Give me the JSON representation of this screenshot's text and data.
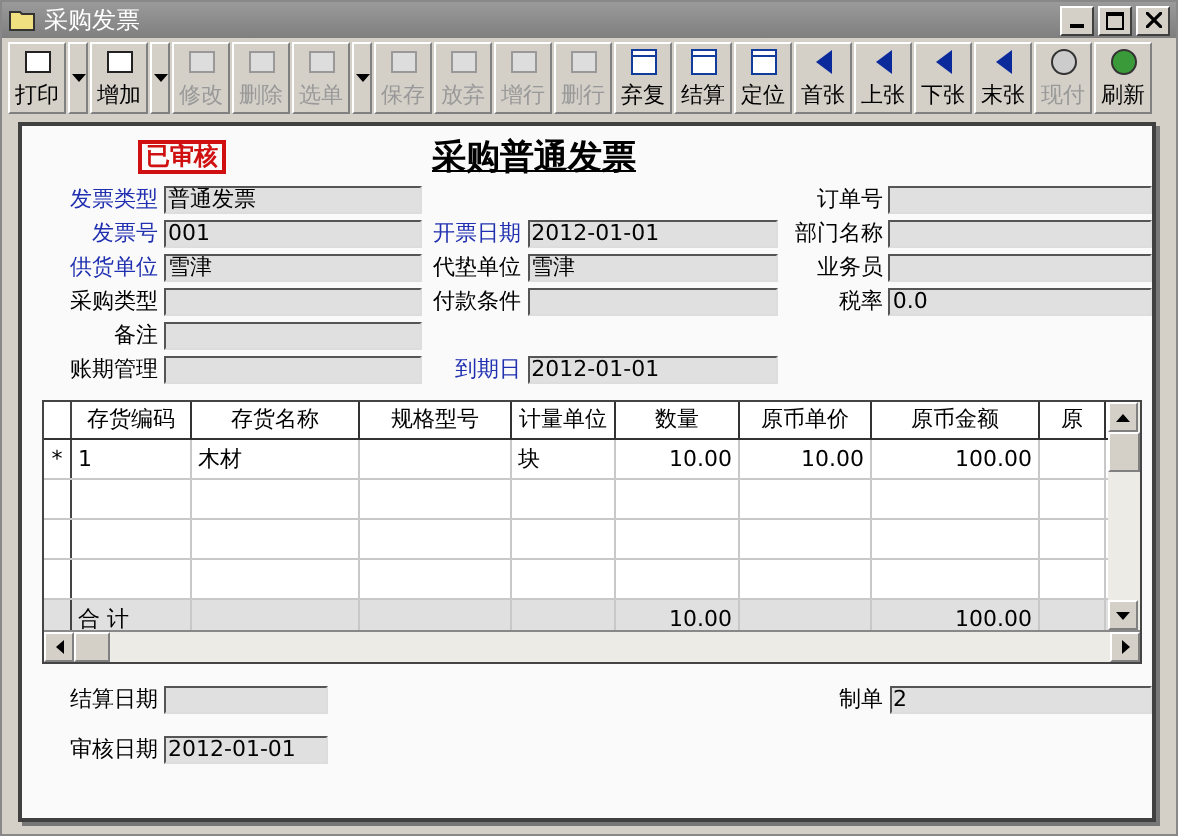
{
  "window": {
    "title": "采购发票"
  },
  "toolbar": [
    {
      "kind": "button",
      "label": "打印",
      "disabled": false
    },
    {
      "kind": "dropdown",
      "disabled": false
    },
    {
      "kind": "button",
      "label": "增加",
      "disabled": false
    },
    {
      "kind": "dropdown",
      "disabled": false
    },
    {
      "kind": "button",
      "label": "修改",
      "disabled": true
    },
    {
      "kind": "button",
      "label": "删除",
      "disabled": true
    },
    {
      "kind": "button",
      "label": "选单",
      "disabled": true
    },
    {
      "kind": "dropdown",
      "disabled": false
    },
    {
      "kind": "button",
      "label": "保存",
      "disabled": true
    },
    {
      "kind": "button",
      "label": "放弃",
      "disabled": true
    },
    {
      "kind": "button",
      "label": "增行",
      "disabled": true
    },
    {
      "kind": "button",
      "label": "删行",
      "disabled": true
    },
    {
      "kind": "button",
      "label": "弃复",
      "disabled": false
    },
    {
      "kind": "button",
      "label": "结算",
      "disabled": false
    },
    {
      "kind": "button",
      "label": "定位",
      "disabled": false
    },
    {
      "kind": "button",
      "label": "首张",
      "disabled": false
    },
    {
      "kind": "button",
      "label": "上张",
      "disabled": false
    },
    {
      "kind": "button",
      "label": "下张",
      "disabled": false
    },
    {
      "kind": "button",
      "label": "末张",
      "disabled": false
    },
    {
      "kind": "button",
      "label": "现付",
      "disabled": true
    },
    {
      "kind": "button",
      "label": "刷新",
      "disabled": false
    }
  ],
  "stamp": "已审核",
  "form_title": "采购普通发票",
  "header_rows": [
    {
      "left": {
        "label": "发票类型",
        "required": true,
        "value": "普通发票"
      },
      "right": {
        "label": "订单号",
        "required": false
      }
    },
    {
      "left": {
        "label": "发票号",
        "required": true,
        "value": "001"
      },
      "middle": {
        "label": "开票日期",
        "required": true,
        "value": "2012-01-01"
      },
      "right": {
        "label": "部门名称",
        "required": false
      }
    },
    {
      "left": {
        "label": "供货单位",
        "required": true,
        "value": "雪津"
      },
      "middle": {
        "label": "代垫单位",
        "required": false,
        "value": "雪津"
      },
      "right": {
        "label": "业务员",
        "required": false
      }
    },
    {
      "left": {
        "label": "采购类型",
        "required": false
      },
      "middle": {
        "label": "付款条件",
        "required": false
      },
      "right": {
        "label": "税率",
        "required": false,
        "value": "0.0"
      }
    },
    {
      "left": {
        "label": "备注",
        "required": false
      }
    },
    {
      "left": {
        "label": "账期管理",
        "required": false
      },
      "middle": {
        "label": "到期日",
        "required": true,
        "value": "2012-01-01"
      }
    }
  ],
  "table": {
    "columns": [
      "存货编码",
      "存货名称",
      "规格型号",
      "计量单位",
      "数量",
      "原币单价",
      "原币金额",
      "原"
    ],
    "rows": [
      {
        "marker": "*",
        "cells": [
          "1",
          "木材",
          "",
          "块",
          "10.00",
          "10.00",
          "100.00",
          ""
        ]
      }
    ],
    "total": {
      "label": "合  计",
      "cells": [
        "",
        "",
        "",
        "",
        "10.00",
        "",
        "100.00",
        ""
      ]
    }
  },
  "footer": {
    "left": [
      {
        "label": "结算日期"
      },
      {
        "label": "审核日期",
        "value": "2012-01-01"
      }
    ],
    "right": [
      {
        "label": "制单",
        "value": "2"
      }
    ]
  }
}
